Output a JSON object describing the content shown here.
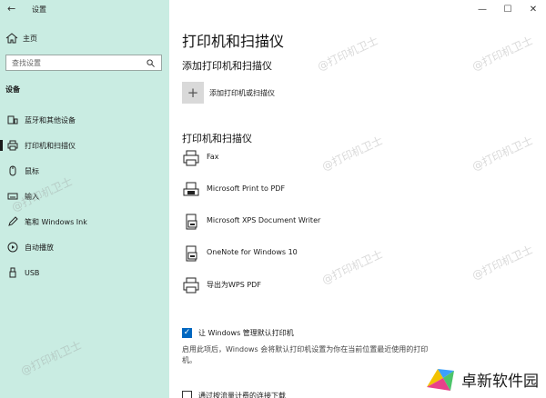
{
  "window": {
    "title": "设置",
    "controls": {
      "minimize": "—",
      "maximize": "☐",
      "close": "✕"
    }
  },
  "sidebar": {
    "home_label": "主页",
    "search_placeholder": "查找设置",
    "section_label": "设备",
    "items": [
      {
        "label": "蓝牙和其他设备",
        "icon": "bluetooth-devices-icon"
      },
      {
        "label": "打印机和扫描仪",
        "icon": "printer-icon",
        "active": true
      },
      {
        "label": "鼠标",
        "icon": "mouse-icon"
      },
      {
        "label": "输入",
        "icon": "keyboard-icon"
      },
      {
        "label": "笔和 Windows Ink",
        "icon": "pen-icon"
      },
      {
        "label": "自动播放",
        "icon": "autoplay-icon"
      },
      {
        "label": "USB",
        "icon": "usb-icon"
      }
    ]
  },
  "main": {
    "page_title": "打印机和扫描仪",
    "add_section_title": "添加打印机和扫描仪",
    "add_button_label": "添加打印机或扫描仪",
    "list_section_title": "打印机和扫描仪",
    "printers": [
      {
        "name": "Fax"
      },
      {
        "name": "Microsoft Print to PDF"
      },
      {
        "name": "Microsoft XPS Document Writer"
      },
      {
        "name": "OneNote for Windows 10"
      },
      {
        "name": "导出为WPS PDF"
      }
    ],
    "manage_default_label": "让 Windows 管理默认打印机",
    "manage_default_checked": true,
    "manage_default_desc": "启用此项后，Windows 会将默认打印机设置为你在当前位置最近使用的打印机。",
    "metered_label": "通过按流量计费的连接下载"
  },
  "watermark_text": "@打印机卫士",
  "brand": {
    "name": "卓新软件园"
  },
  "colors": {
    "sidebar_bg": "#c9ece2",
    "accent": "#0067c0"
  }
}
